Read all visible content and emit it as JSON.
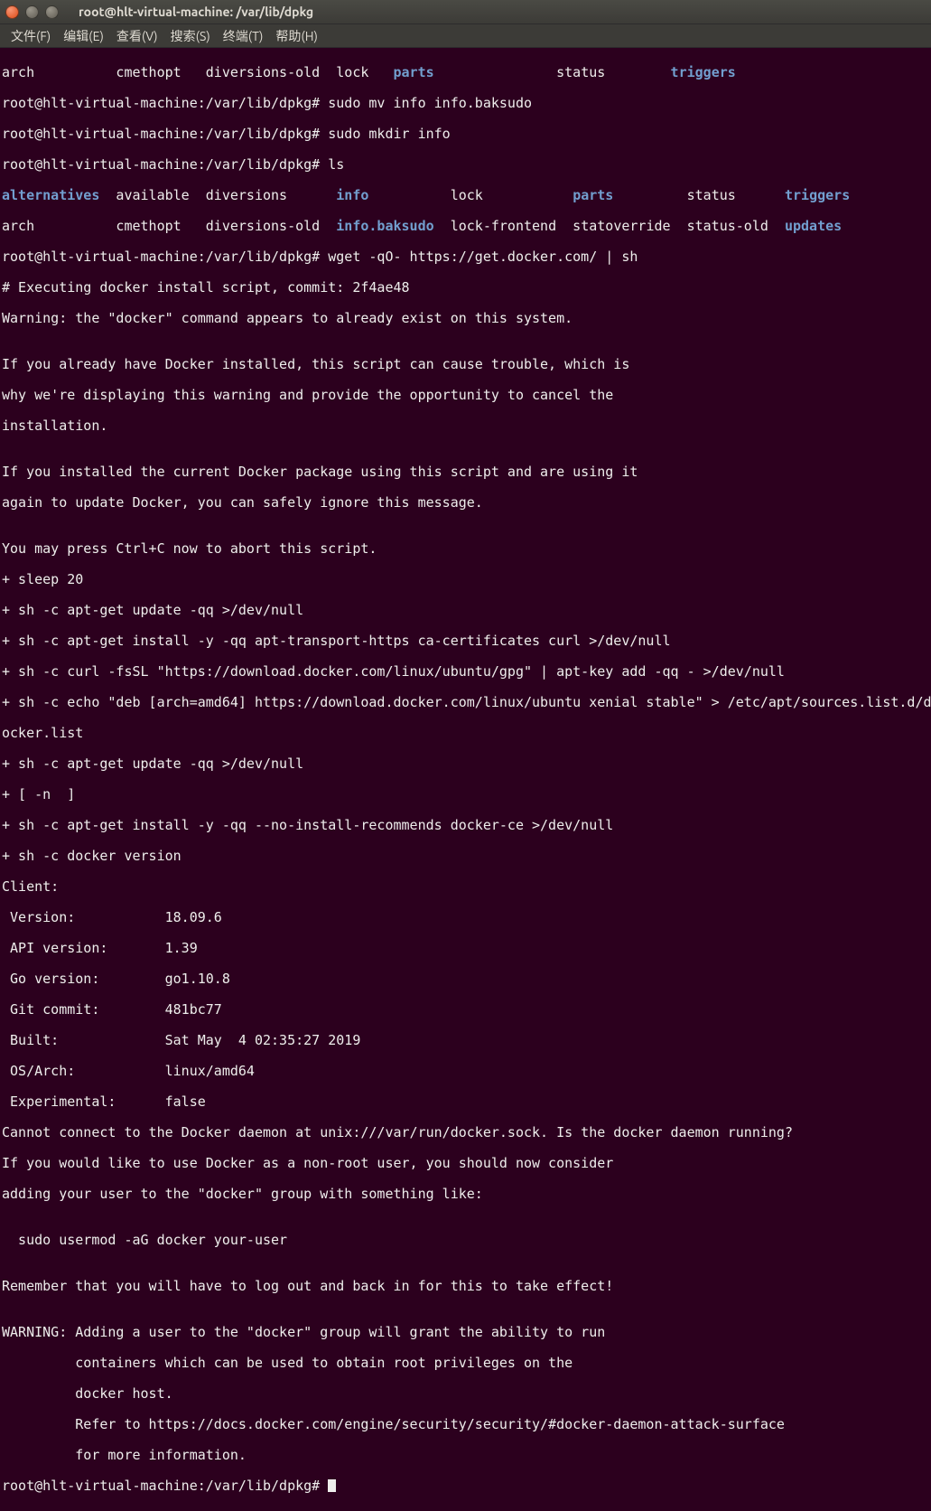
{
  "window": {
    "title": "root@hlt-virtual-machine: /var/lib/dpkg"
  },
  "menu": {
    "file": "文件(F)",
    "edit": "编辑(E)",
    "view": "查看(V)",
    "search": "搜索(S)",
    "terminal": "终端(T)",
    "help": "帮助(H)"
  },
  "term": {
    "l1a": "arch          cmethopt   diversions-old  lock   ",
    "l1b": "parts",
    "l1c": "               status        ",
    "l1d": "triggers",
    "l2": "root@hlt-virtual-machine:/var/lib/dpkg# sudo mv info info.baksudo",
    "l3": "root@hlt-virtual-machine:/var/lib/dpkg# sudo mkdir info",
    "l4": "root@hlt-virtual-machine:/var/lib/dpkg# ls",
    "l5a": "alternatives",
    "l5b": "  available  diversions      ",
    "l5c": "info",
    "l5d": "          lock           ",
    "l5e": "parts",
    "l5f": "         status      ",
    "l5g": "triggers",
    "l6a": "arch          cmethopt   diversions-old  ",
    "l6b": "info.baksudo",
    "l6c": "  lock-frontend  statoverride  status-old  ",
    "l6d": "updates",
    "l7": "root@hlt-virtual-machine:/var/lib/dpkg# wget -qO- https://get.docker.com/ | sh",
    "l8": "# Executing docker install script, commit: 2f4ae48",
    "l9": "Warning: the \"docker\" command appears to already exist on this system.",
    "l10": "",
    "l11": "If you already have Docker installed, this script can cause trouble, which is",
    "l12": "why we're displaying this warning and provide the opportunity to cancel the",
    "l13": "installation.",
    "l14": "",
    "l15": "If you installed the current Docker package using this script and are using it",
    "l16": "again to update Docker, you can safely ignore this message.",
    "l17": "",
    "l18": "You may press Ctrl+C now to abort this script.",
    "l19": "+ sleep 20",
    "l20": "+ sh -c apt-get update -qq >/dev/null",
    "l21": "+ sh -c apt-get install -y -qq apt-transport-https ca-certificates curl >/dev/null",
    "l22": "+ sh -c curl -fsSL \"https://download.docker.com/linux/ubuntu/gpg\" | apt-key add -qq - >/dev/null",
    "l23": "+ sh -c echo \"deb [arch=amd64] https://download.docker.com/linux/ubuntu xenial stable\" > /etc/apt/sources.list.d/d",
    "l24": "ocker.list",
    "l25": "+ sh -c apt-get update -qq >/dev/null",
    "l26": "+ [ -n  ]",
    "l27": "+ sh -c apt-get install -y -qq --no-install-recommends docker-ce >/dev/null",
    "l28": "+ sh -c docker version",
    "l29": "Client:",
    "l30": " Version:           18.09.6",
    "l31": " API version:       1.39",
    "l32": " Go version:        go1.10.8",
    "l33": " Git commit:        481bc77",
    "l34": " Built:             Sat May  4 02:35:27 2019",
    "l35": " OS/Arch:           linux/amd64",
    "l36": " Experimental:      false",
    "l37": "Cannot connect to the Docker daemon at unix:///var/run/docker.sock. Is the docker daemon running?",
    "l38": "If you would like to use Docker as a non-root user, you should now consider",
    "l39": "adding your user to the \"docker\" group with something like:",
    "l40": "",
    "l41": "  sudo usermod -aG docker your-user",
    "l42": "",
    "l43": "Remember that you will have to log out and back in for this to take effect!",
    "l44": "",
    "l45": "WARNING: Adding a user to the \"docker\" group will grant the ability to run",
    "l46": "         containers which can be used to obtain root privileges on the",
    "l47": "         docker host.",
    "l48": "         Refer to https://docs.docker.com/engine/security/security/#docker-daemon-attack-surface",
    "l49": "         for more information.",
    "l50": "root@hlt-virtual-machine:/var/lib/dpkg# "
  }
}
